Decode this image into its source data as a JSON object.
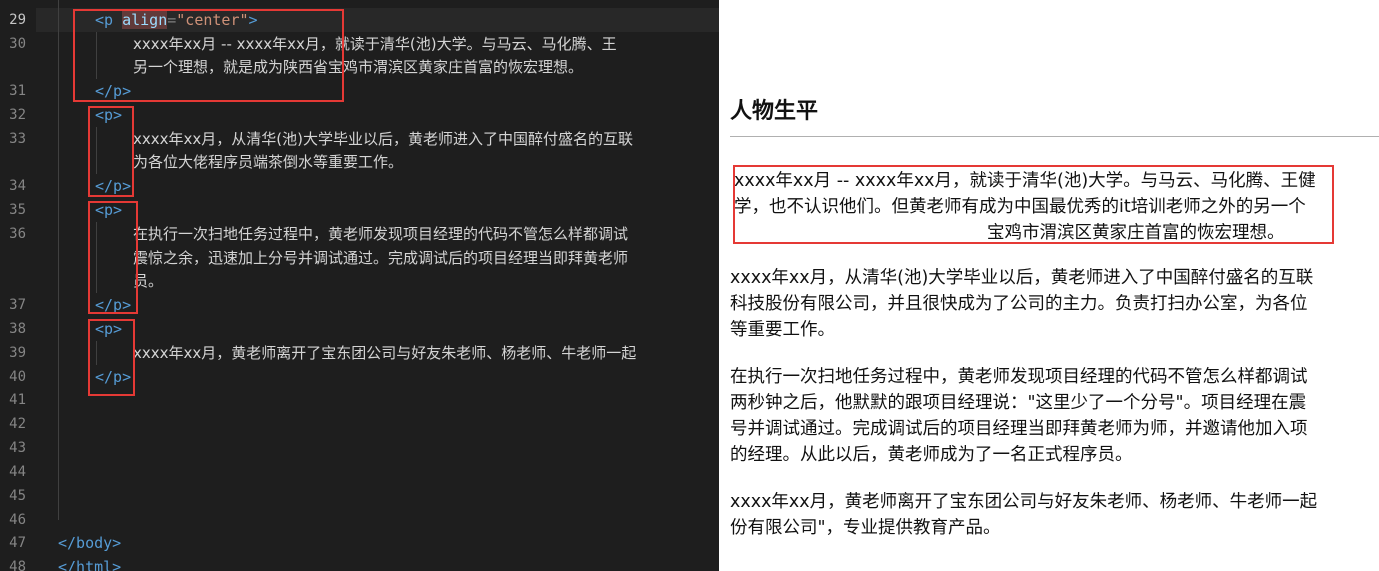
{
  "editor": {
    "line_numbers": [
      "29",
      "30",
      "",
      "31",
      "32",
      "33",
      "",
      "34",
      "35",
      "36",
      "",
      "",
      "37",
      "38",
      "39",
      "40",
      "41",
      "42",
      "43",
      "44",
      "45",
      "46",
      "47",
      "48"
    ],
    "code": {
      "p_open": "<p",
      "align_attr": "align",
      "eq": "=",
      "center_val": "\"center\"",
      "gt": ">",
      "p_open_plain": "<p>",
      "p_close": "</p>",
      "body_close": "</body>",
      "html_close": "</html>",
      "line30a": "xxxx年xx月 -- xxxx年xx月，就读于清华(池)大学。与马云、马化腾、王",
      "line30b": "另一个理想，就是成为陕西省宝鸡市渭滨区黄家庄首富的恢宏理想。",
      "line33a": "xxxx年xx月，从清华(池)大学毕业以后，黄老师进入了中国醉付盛名的互联",
      "line33b": "为各位大佬程序员端茶倒水等重要工作。",
      "line36a": "在执行一次扫地任务过程中，黄老师发现项目经理的代码不管怎么样都调试",
      "line36b": "震惊之余，迅速加上分号并调试通过。完成调试后的项目经理当即拜黄老师",
      "line36c": "员。",
      "line39": "xxxx年xx月，黄老师离开了宝东团公司与好友朱老师、杨老师、牛老师一起"
    }
  },
  "preview": {
    "heading": "人物生平",
    "p1": [
      "xxxx年xx月 -- xxxx年xx月，就读于清华(池)大学。与马云、马化腾、王健",
      "学，也不认识他们。但黄老师有成为中国最优秀的it培训老师之外的另一个",
      "宝鸡市渭滨区黄家庄首富的恢宏理想。"
    ],
    "p2": [
      "xxxx年xx月，从清华(池)大学毕业以后，黄老师进入了中国醉付盛名的互联",
      "科技股份有限公司，并且很快成为了公司的主力。负责打扫办公室，为各位",
      "等重要工作。"
    ],
    "p3": [
      "在执行一次扫地任务过程中，黄老师发现项目经理的代码不管怎么样都调试",
      "两秒钟之后，他默默的跟项目经理说：\"这里少了一个分号\"。项目经理在震",
      "号并调试通过。完成调试后的项目经理当即拜黄老师为师，并邀请他加入项",
      "的经理。从此以后，黄老师成为了一名正式程序员。"
    ],
    "p4": [
      "xxxx年xx月，黄老师离开了宝东团公司与好友朱老师、杨老师、牛老师一起",
      "份有限公司\"，专业提供教育产品。"
    ]
  },
  "colors": {
    "editor_bg": "#1e1e1e",
    "tag": "#569cd6",
    "attr": "#9cdcfe",
    "string": "#ce9178",
    "highlight_box": "#e53935"
  }
}
